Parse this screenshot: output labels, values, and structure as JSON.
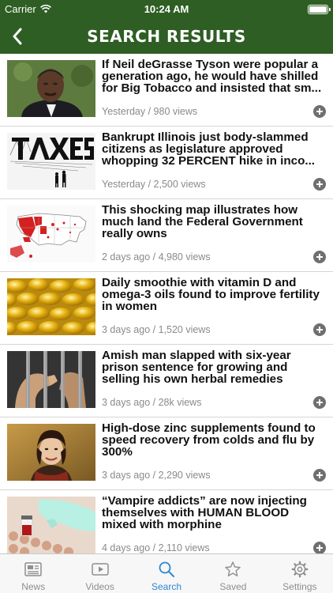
{
  "status": {
    "carrier": "Carrier",
    "time": "10:24 AM"
  },
  "nav": {
    "title": "SEARCH RESULTS",
    "back_icon": "chevron-left-icon"
  },
  "articles": [
    {
      "headline": "If Neil deGrasse Tyson were popular a generation ago, he would have shilled for Big Tobacco and insisted that sm...",
      "meta": "Yesterday / 980 views",
      "thumb": "portrait-man"
    },
    {
      "headline": "Bankrupt Illinois just body-slammed citizens as legislature approved whopping 32 PERCENT hike in inco...",
      "meta": "Yesterday / 2,500 views",
      "thumb": "taxes-illustration"
    },
    {
      "headline": "This shocking map illustrates how much land the Federal Government really owns",
      "meta": "2 days ago / 4,980 views",
      "thumb": "us-map"
    },
    {
      "headline": "Daily smoothie with vitamin D and omega-3 oils found to improve fertility in women",
      "meta": "3 days ago / 1,520 views",
      "thumb": "gel-capsules"
    },
    {
      "headline": "Amish man slapped with six-year prison sentence for growing and selling his own herbal remedies",
      "meta": "3 days ago / 28k views",
      "thumb": "prison-bars"
    },
    {
      "headline": "High-dose zinc supplements found to speed recovery from colds and flu by 300%",
      "meta": "3 days ago / 2,290 views",
      "thumb": "woman-scarf"
    },
    {
      "headline": "“Vampire addicts” are now injecting themselves with HUMAN BLOOD mixed with morphine",
      "meta": "4 days ago / 2,110 views",
      "thumb": "blood-vial"
    }
  ],
  "tabs": [
    {
      "label": "News",
      "icon": "newspaper-icon"
    },
    {
      "label": "Videos",
      "icon": "video-icon"
    },
    {
      "label": "Search",
      "icon": "search-icon"
    },
    {
      "label": "Saved",
      "icon": "star-icon"
    },
    {
      "label": "Settings",
      "icon": "gear-icon"
    }
  ],
  "active_tab": "Search",
  "colors": {
    "header": "#2e5e24",
    "active_tab": "#2d86d1",
    "meta_text": "#8a8a8a"
  }
}
